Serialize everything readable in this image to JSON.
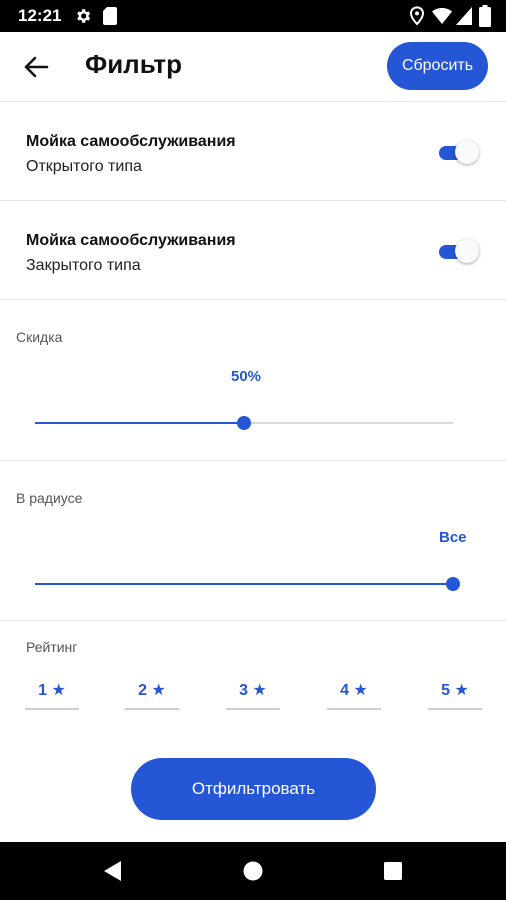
{
  "status_bar": {
    "time": "12:21",
    "icons": [
      "gear-icon",
      "sim-card-icon",
      "location-icon",
      "wifi-icon",
      "signal-icon",
      "battery-icon"
    ]
  },
  "header": {
    "title": "Фильтр",
    "back_icon": "arrow-left-icon",
    "reset_label": "Сбросить"
  },
  "toggles": [
    {
      "title": "Мойка самообслуживания",
      "subtitle": "Открытого типа",
      "enabled": true
    },
    {
      "title": "Мойка самообслуживания",
      "subtitle": "Закрытого типа",
      "enabled": true
    }
  ],
  "discount": {
    "label": "Скидка",
    "value_label": "50%",
    "fraction": 0.5
  },
  "radius": {
    "label": "В радиусе",
    "value_label": "Все",
    "fraction": 1.0
  },
  "rating": {
    "label": "Рейтинг",
    "options": [
      "1",
      "2",
      "3",
      "4",
      "5"
    ],
    "star_icon": "star-icon"
  },
  "filter_button": {
    "label": "Отфильтровать"
  },
  "nav_bar": {
    "icons": [
      "back-triangle-icon",
      "home-circle-icon",
      "recents-square-icon"
    ]
  },
  "colors": {
    "accent": "#2456d6",
    "divider": "#e4e4e4",
    "rail": "#d9d9d9"
  }
}
